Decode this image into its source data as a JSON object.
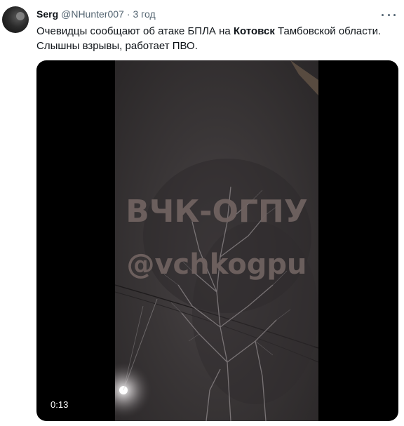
{
  "tweet": {
    "author_name": "Serg",
    "handle": "@NHunter007",
    "separator": "·",
    "time": "3 год",
    "text_before": "Очевидцы сообщают об атаке БПЛА на ",
    "text_bold": "Котовск",
    "text_after": " Тамбовской области. Слышны взрывы, работает ПВО.",
    "more_icon": "more-horizontal-icon"
  },
  "video": {
    "watermark_line1": "ВЧК-ОГПУ",
    "watermark_line2": "@vchkogpu",
    "duration": "0:13"
  }
}
